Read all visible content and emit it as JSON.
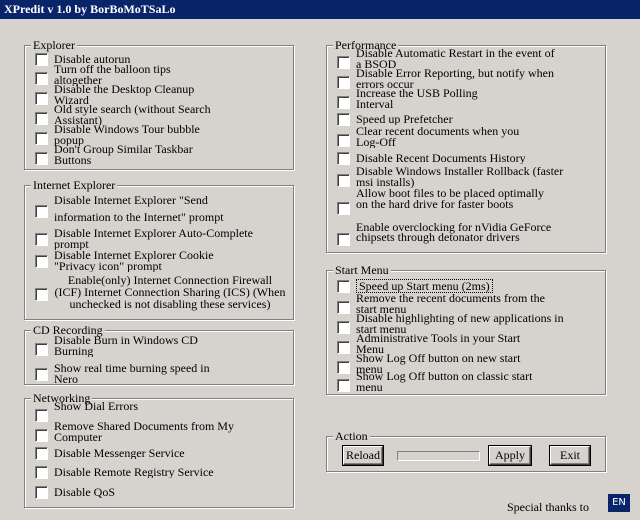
{
  "window": {
    "title": "XPredit v 1.0 by BorBoMoTSaLo",
    "buttons": {
      "minimize": "_",
      "maximize": "□",
      "close": "×"
    }
  },
  "explorer": {
    "legend": "Explorer",
    "items": [
      "Disable autorun",
      "Turn off the balloon tips altogether",
      "Disable the Desktop Cleanup Wizard",
      "Old style search (without Search Assistant)",
      "Disable Windows Tour bubble popup",
      "Don't Group Similar Taskbar Buttons"
    ]
  },
  "internet_explorer": {
    "legend": "Internet Explorer",
    "items": [
      "Disable Internet Explorer \"Send information to the Internet\" prompt",
      "Disable Internet Explorer Auto-Complete prompt",
      "Disable Internet Explorer Cookie \"Privacy icon\" prompt",
      "Enable(only) Internet Connection Firewall (ICF) Internet Connection Sharing (ICS) (When unchecked is not disabling these services)"
    ]
  },
  "cd_recording": {
    "legend": "CD Recording",
    "items": [
      "Disable Burn in Windows CD Burning",
      "Show real time burning speed in Nero"
    ]
  },
  "networking": {
    "legend": "Networking",
    "items": [
      "Show Dial Errors",
      "Remove Shared Documents from My Computer",
      "Disable Messenger Service",
      "Disable Remote Registry Service",
      "Disable QoS"
    ]
  },
  "performance": {
    "legend": "Performance",
    "items": [
      "Disable Automatic Restart in the event of a BSOD",
      "Disable Error Reporting, but notify when errors occur",
      "Increase the USB Polling Interval",
      "Speed up Prefetcher",
      "Clear recent documents when you Log-Off",
      "Disable Recent Documents History",
      "Disable Windows Installer Rollback (faster msi installs)",
      "Allow boot files to be placed optimally on the hard drive for faster boots",
      "Enable overclocking for nVidia GeForce chipsets through detonator drivers"
    ]
  },
  "start_menu": {
    "legend": "Start Menu",
    "items": [
      "Speed up Start menu (2ms)",
      "Remove the recent documents from the start menu",
      "Disable highlighting of new applications in start menu",
      "Administrative Tools in your Start Menu",
      "Show Log Off button on new start menu",
      "Show Log Off button on classic start menu"
    ]
  },
  "action": {
    "legend": "Action",
    "reload": "Reload",
    "apply": "Apply",
    "exit": "Exit",
    "progress": 0
  },
  "footer": {
    "thanks": "Special thanks to",
    "language": "EN"
  }
}
